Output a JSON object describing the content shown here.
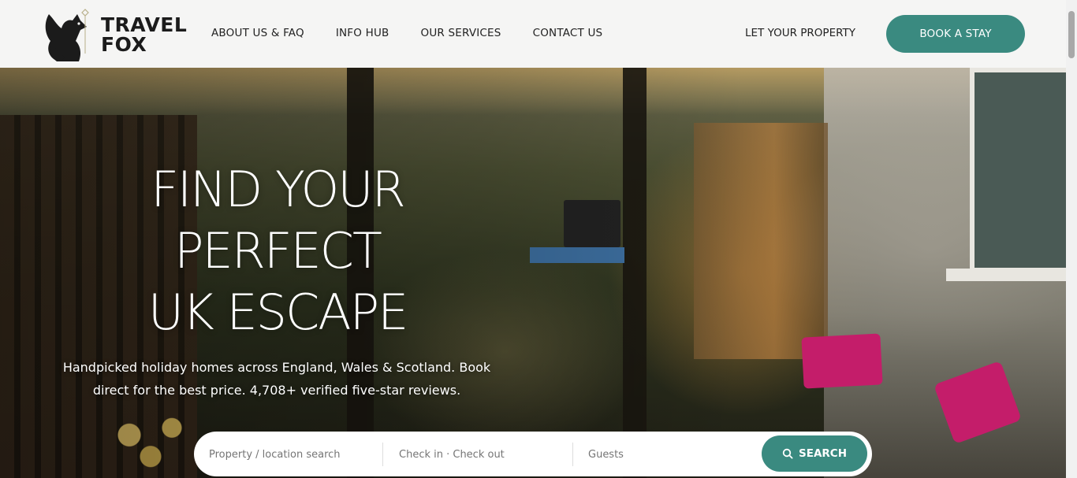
{
  "brand": {
    "line1": "TRAVEL",
    "line2": "FOX",
    "accent_color": "#3a8a80"
  },
  "nav": {
    "items": [
      "ABOUT US & FAQ",
      "INFO HUB",
      "OUR SERVICES",
      "CONTACT US"
    ],
    "let_property": "LET YOUR PROPERTY",
    "book_stay": "BOOK A STAY"
  },
  "hero": {
    "headline": [
      "FIND YOUR",
      "PERFECT",
      "UK ESCAPE"
    ],
    "subtext_line1": "Handpicked holiday homes across England, Wales & Scotland. Book",
    "subtext_line2": "direct for the best price. 4,708+ verified five-star reviews."
  },
  "search": {
    "location_placeholder": "Property / location search",
    "dates_placeholder": "Check in · Check out",
    "guests_placeholder": "Guests",
    "button_label": "SEARCH",
    "button_icon": "search-icon"
  }
}
